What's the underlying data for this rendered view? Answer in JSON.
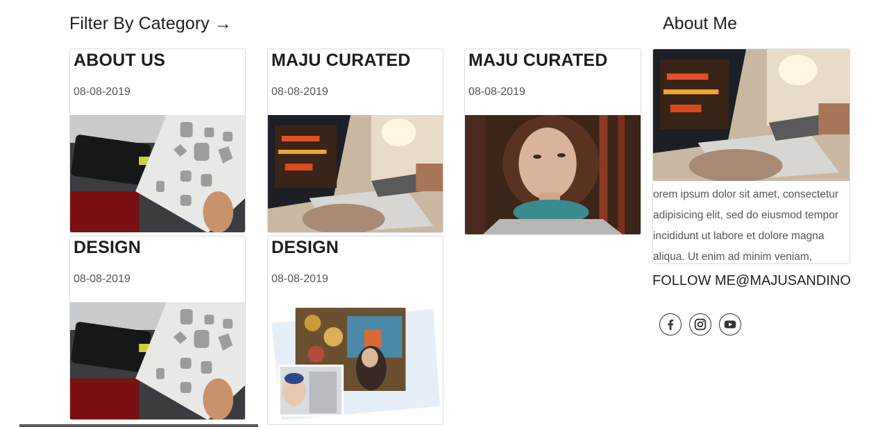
{
  "filter": {
    "heading": "Filter By Category →"
  },
  "posts": [
    {
      "title": "ABOUT US",
      "date": "08-08-2019",
      "image": "sketchbook-photo"
    },
    {
      "title": "MAJU CURATED",
      "date": "08-08-2019",
      "image": "laptop-tablet-photo"
    },
    {
      "title": "MAJU CURATED",
      "date": "08-08-2019",
      "image": "woman-portrait-photo"
    },
    {
      "title": "DESIGN",
      "date": "08-08-2019",
      "image": "sketchbook-photo"
    },
    {
      "title": "DESIGN",
      "date": "08-08-2019",
      "image": "travel-collage-photo"
    }
  ],
  "sidebar": {
    "heading": "About Me",
    "image": "laptop-tablet-photo",
    "text": " orem ipsum dolor sit amet, consectetur adipisicing elit, sed do eiusmod tempor incididunt ut labore et dolore magna aliqua. Ut enim ad minim veniam,",
    "follow": "FOLLOW ME@MAJUSANDINO",
    "socials": [
      "facebook-icon",
      "instagram-icon",
      "youtube-icon"
    ]
  }
}
